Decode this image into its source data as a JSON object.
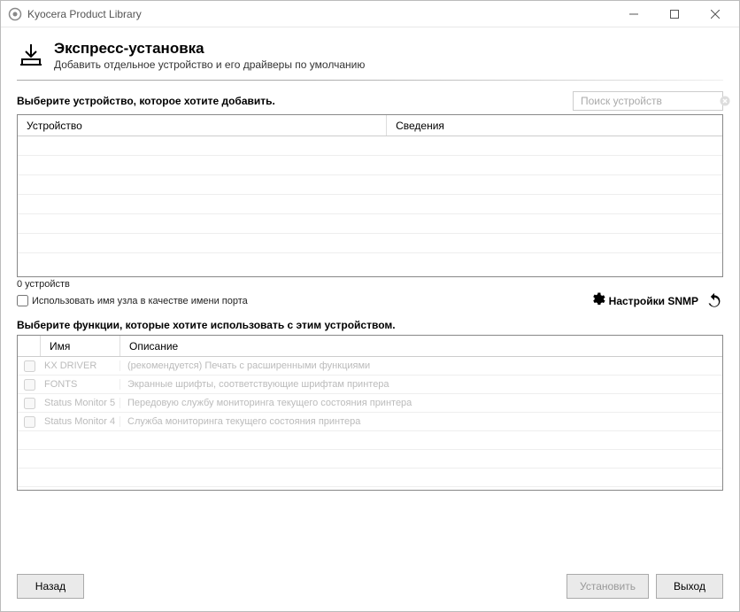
{
  "window": {
    "title": "Kyocera Product Library"
  },
  "header": {
    "title": "Экспресс-установка",
    "subtitle": "Добавить отдельное устройство и его драйверы по умолчанию"
  },
  "devices": {
    "prompt": "Выберите устройство, которое хотите добавить.",
    "search_placeholder": "Поиск устройств",
    "columns": {
      "device": "Устройство",
      "details": "Сведения"
    },
    "count_text": "0 устройств",
    "host_checkbox_label": "Использовать имя узла в качестве имени порта",
    "snmp_label": "Настройки SNMP"
  },
  "features": {
    "prompt": "Выберите функции, которые хотите использовать с этим устройством.",
    "columns": {
      "name": "Имя",
      "desc": "Описание"
    },
    "rows": [
      {
        "name": "KX DRIVER",
        "desc": "(рекомендуется) Печать с расширенными функциями"
      },
      {
        "name": "FONTS",
        "desc": "Экранные шрифты, соответствующие шрифтам принтера"
      },
      {
        "name": "Status Monitor 5",
        "desc": "Передовую службу мониторинга текущего состояния принтера"
      },
      {
        "name": "Status Monitor 4",
        "desc": "Служба мониторинга текущего состояния принтера"
      }
    ]
  },
  "footer": {
    "back": "Назад",
    "install": "Установить",
    "exit": "Выход"
  }
}
